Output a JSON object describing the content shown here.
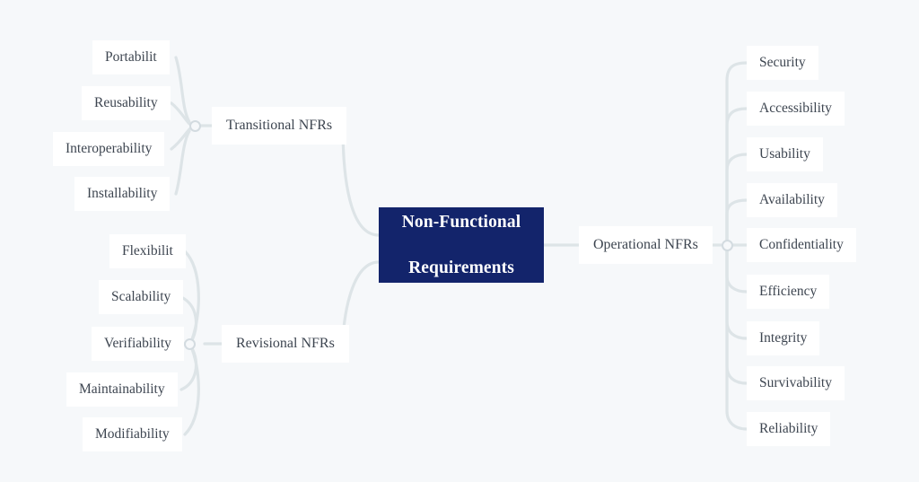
{
  "diagram": {
    "type": "mind-map",
    "background_color": "#f6f8fa",
    "center": {
      "line1": "Non-Functional",
      "line2": "Requirements",
      "fill_color": "#13246b",
      "text_color": "#ffffff"
    },
    "node_text_color": "#3d4550",
    "node_fill_color": "#ffffff",
    "connector_color": "#dde4e7",
    "branches": [
      {
        "label": "Transitional NFRs",
        "side": "left",
        "children": [
          "Portabilit",
          "Reusability",
          "Interoperability",
          "Installability"
        ]
      },
      {
        "label": "Revisional NFRs",
        "side": "left",
        "children": [
          "Flexibilit",
          "Scalability",
          "Verifiability",
          "Maintainability",
          "Modifiability"
        ]
      },
      {
        "label": "Operational NFRs",
        "side": "right",
        "children": [
          "Security",
          "Accessibility",
          "Usability",
          "Availability",
          "Confidentiality",
          "Efficiency",
          "Integrity",
          "Survivability",
          "Reliability"
        ]
      }
    ]
  }
}
